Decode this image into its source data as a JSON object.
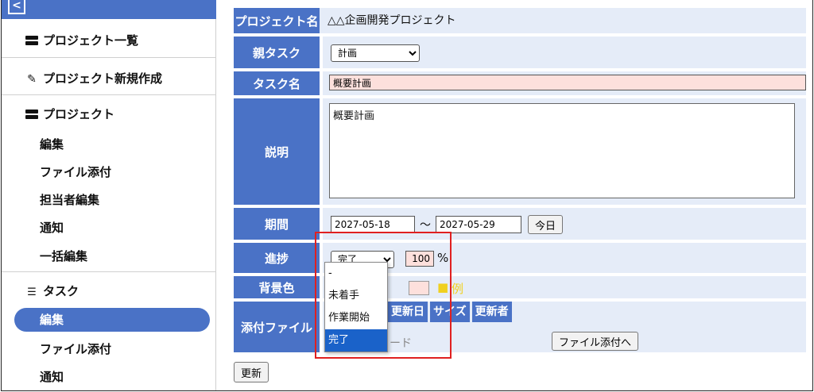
{
  "sidebar": {
    "back_label": "<",
    "items": [
      {
        "label": "プロジェクト一覧"
      },
      {
        "label": "プロジェクト新規作成"
      },
      {
        "label": "プロジェクト"
      },
      {
        "label": "編集"
      },
      {
        "label": "ファイル添付"
      },
      {
        "label": "担当者編集"
      },
      {
        "label": "通知"
      },
      {
        "label": "一括編集"
      },
      {
        "label": "タスク"
      },
      {
        "label": "編集"
      },
      {
        "label": "ファイル添付"
      },
      {
        "label": "通知"
      }
    ]
  },
  "form": {
    "project_name_label": "プロジェクト名",
    "project_name_value": "△△企画開発プロジェクト",
    "parent_task_label": "親タスク",
    "parent_task_value": "計画",
    "task_name_label": "タスク名",
    "task_name_value": "概要計画",
    "description_label": "説明",
    "description_value": "概要計画",
    "period_label": "期間",
    "period_start": "2027-05-18",
    "period_sep": "〜",
    "period_end": "2027-05-29",
    "today_button": "今日",
    "progress_label": "進捗",
    "progress_status": "完了",
    "progress_percent": "100",
    "percent_sign": "%",
    "bg_color_label": "背景色",
    "bg_color_example": "例",
    "attach_label": "添付ファイル",
    "attach_columns": [
      "更新日",
      "サイズ",
      "更新者"
    ],
    "attach_upload_partial": "ード",
    "attach_button": "ファイル添付へ",
    "update_button": "更新"
  },
  "dropdown": {
    "options": [
      "-",
      "未着手",
      "作業開始",
      "完了"
    ],
    "selected_index": 3
  },
  "colors": {
    "accent": "#4a72c6",
    "row_bg": "#e5ecf8",
    "highlight": "#e02020",
    "input_pink": "#fde0dc",
    "example_yellow": "#f0d020"
  }
}
